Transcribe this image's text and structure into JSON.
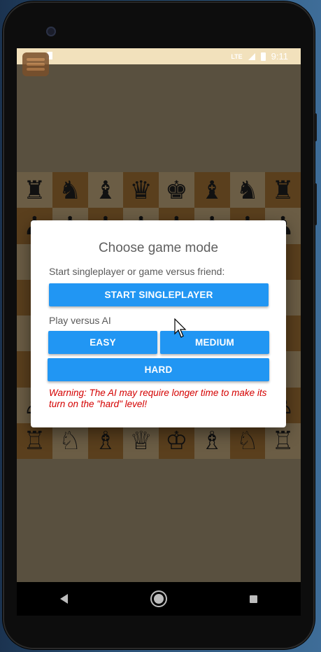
{
  "status_bar": {
    "time": "9:11",
    "signal": "LTE"
  },
  "board": {
    "rows": [
      [
        "♜",
        "♞",
        "♝",
        "♛",
        "♚",
        "♝",
        "♞",
        "♜"
      ],
      [
        "♟",
        "♟",
        "♟",
        "♟",
        "♟",
        "♟",
        "♟",
        "♟"
      ],
      [
        "",
        "",
        "",
        "",
        "",
        "",
        "",
        ""
      ],
      [
        "",
        "",
        "",
        "",
        "",
        "",
        "",
        ""
      ],
      [
        "",
        "",
        "",
        "",
        "",
        "",
        "",
        ""
      ],
      [
        "",
        "",
        "",
        "",
        "",
        "",
        "",
        ""
      ],
      [
        "♙",
        "♙",
        "♙",
        "♙",
        "♙",
        "♙",
        "♙",
        "♙"
      ],
      [
        "♖",
        "♘",
        "♗",
        "♕",
        "♔",
        "♗",
        "♘",
        "♖"
      ]
    ]
  },
  "dialog": {
    "title": "Choose game mode",
    "subtitle": "Start singleplayer or game versus friend:",
    "singleplayer_button": "START SINGLEPLAYER",
    "ai_label": "Play versus AI",
    "easy_button": "EASY",
    "medium_button": "MEDIUM",
    "hard_button": "HARD",
    "warning": "Warning: The AI may require longer time to make its turn on the \"hard\" level!"
  },
  "colors": {
    "accent": "#2196f3",
    "warning": "#d40000",
    "status_bar": "#f2e1bc"
  },
  "icons": {
    "back": "back-icon",
    "home": "home-icon",
    "recents": "recents-icon",
    "menu": "menu-icon"
  }
}
